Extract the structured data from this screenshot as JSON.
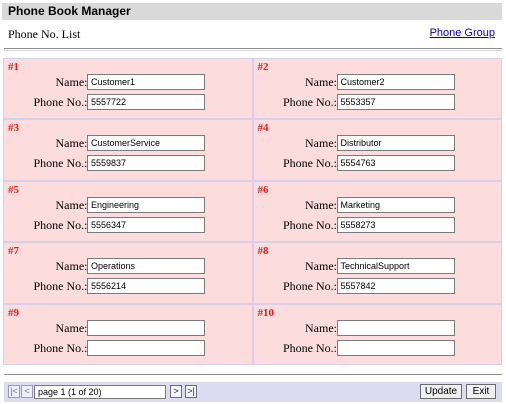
{
  "app": {
    "title": "Phone Book Manager"
  },
  "header": {
    "subtitle": "Phone No. List",
    "group_link": "Phone Group"
  },
  "labels": {
    "name": "Name:",
    "phone": "Phone No.:"
  },
  "entries": [
    {
      "num": "#1",
      "name": "Customer1",
      "phone": "5557722"
    },
    {
      "num": "#2",
      "name": "Customer2",
      "phone": "5553357"
    },
    {
      "num": "#3",
      "name": "CustomerService",
      "phone": "5559837"
    },
    {
      "num": "#4",
      "name": "Distributor",
      "phone": "5554763"
    },
    {
      "num": "#5",
      "name": "Engineering",
      "phone": "5556347"
    },
    {
      "num": "#6",
      "name": "Marketing",
      "phone": "5558273"
    },
    {
      "num": "#7",
      "name": "Operations",
      "phone": "5556214"
    },
    {
      "num": "#8",
      "name": "TechnicalSupport",
      "phone": "5557842"
    },
    {
      "num": "#9",
      "name": "",
      "phone": ""
    },
    {
      "num": "#10",
      "name": "",
      "phone": ""
    }
  ],
  "footer": {
    "first_icon": "|<",
    "prev_icon": "<",
    "next_icon": ">",
    "last_icon": ">|",
    "page_text": "page 1 (1 of 20)",
    "update_label": "Update",
    "exit_label": "Exit"
  }
}
